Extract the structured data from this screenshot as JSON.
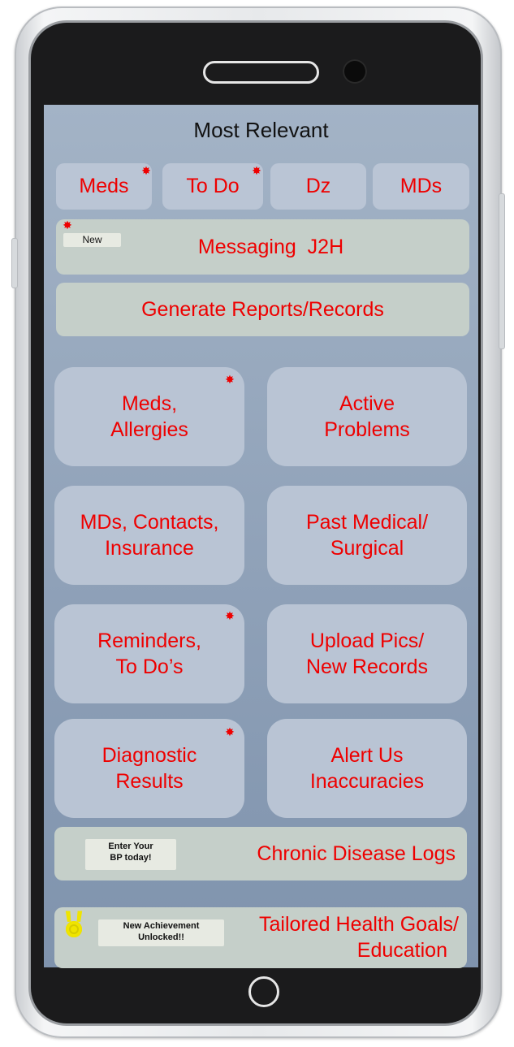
{
  "header": {
    "title": "Most Relevant"
  },
  "tabs": [
    {
      "label": "Meds",
      "has_alert": true
    },
    {
      "label": "To Do",
      "has_alert": true
    },
    {
      "label": "Dz",
      "has_alert": false
    },
    {
      "label": "MDs",
      "has_alert": false
    }
  ],
  "messaging": {
    "label": "Messaging  J2H",
    "badge": "New"
  },
  "reports": {
    "label": "Generate Reports/Records"
  },
  "grid": [
    {
      "line1": "Meds,",
      "line2": "Allergies"
    },
    {
      "line1": "Active",
      "line2": "Problems"
    },
    {
      "line1": "MDs, Contacts,",
      "line2": "Insurance"
    },
    {
      "line1": "Past Medical/",
      "line2": "Surgical"
    },
    {
      "line1": "Reminders,",
      "line2": "To Do’s"
    },
    {
      "line1": "Upload Pics/",
      "line2": "New Records"
    },
    {
      "line1": "Diagnostic",
      "line2": "Results"
    },
    {
      "line1": "Alert Us",
      "line2": "Inaccuracies"
    }
  ],
  "chronic": {
    "label": "Chronic Disease Logs",
    "chip_line1": "Enter Your",
    "chip_line2": "BP today!"
  },
  "goals": {
    "line1": "Tailored Health Goals/",
    "line2": "Education",
    "chip_line1": "New Achievement",
    "chip_line2": "Unlocked!!"
  },
  "colors": {
    "accent": "#ee0000",
    "screen_bg": "#98a9bf",
    "tile_bg": "#b9c4d4",
    "bar_bg": "#c5cfc9",
    "medal": "#efe400"
  }
}
